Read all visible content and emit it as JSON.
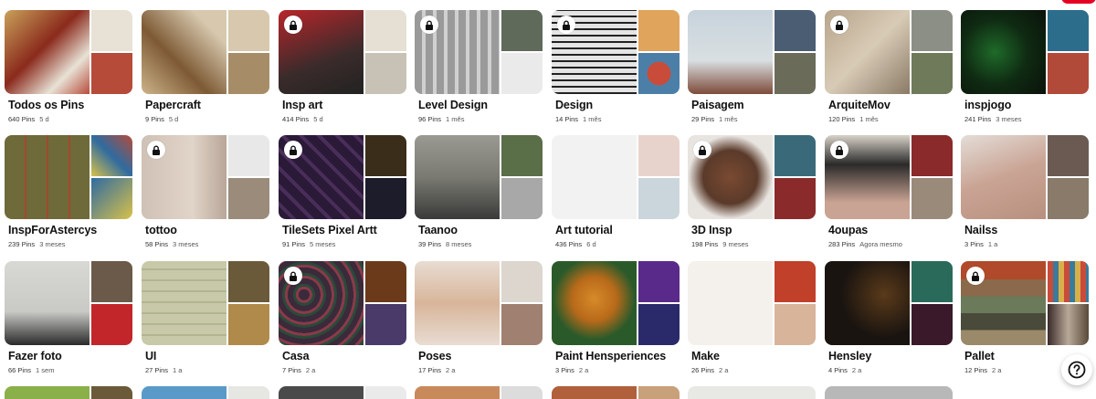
{
  "boards": [
    {
      "title": "Todos os Pins",
      "pins": "640 Pins",
      "time": "5 d",
      "locked": false,
      "colors": [
        "#c9a15a",
        "#8a2a1c",
        "#e8e2d6",
        "#b64b3a"
      ]
    },
    {
      "title": "Papercraft",
      "pins": "9 Pins",
      "time": "5 d",
      "locked": false,
      "colors": [
        "#cdb48a",
        "#7d5a35",
        "#d7c8ae",
        "#a78d67"
      ]
    },
    {
      "title": "Insp art",
      "pins": "414 Pins",
      "time": "5 d",
      "locked": true,
      "colors": [
        "#b7252a",
        "#3b2b2b",
        "#e6e0d4",
        "#222222"
      ]
    },
    {
      "title": "Level Design",
      "pins": "96 Pins",
      "time": "1 mês",
      "locked": true,
      "colors": [
        "#9a9a9a",
        "#5f6a5a",
        "#2e2e2e",
        "#eaeaea"
      ]
    },
    {
      "title": "Design",
      "pins": "14 Pins",
      "time": "1 mês",
      "locked": true,
      "colors": [
        "#d8d8d8",
        "#e0a45c",
        "#c94b3a",
        "#4c7fa8"
      ]
    },
    {
      "title": "Paisagem",
      "pins": "29 Pins",
      "time": "1 mês",
      "locked": false,
      "colors": [
        "#c7d3dc",
        "#7d4b3a",
        "#4b5d73",
        "#6b6b5a"
      ]
    },
    {
      "title": "ArquiteMov",
      "pins": "120 Pins",
      "time": "1 mês",
      "locked": true,
      "colors": [
        "#b7a48a",
        "#8c8f86",
        "#6e7a5a",
        "#a59c8a"
      ]
    },
    {
      "title": "inspjogo",
      "pins": "241 Pins",
      "time": "3 meses",
      "locked": false,
      "colors": [
        "#0f2a12",
        "#2c6d8c",
        "#b24a3a",
        "#1a1a1a"
      ]
    },
    {
      "title": "InspForAstercys",
      "pins": "239 Pins",
      "time": "3 meses",
      "locked": false,
      "colors": [
        "#6e6a3a",
        "#a04a2c",
        "#2f6ba0",
        "#d8c14a"
      ]
    },
    {
      "title": "tottoo",
      "pins": "58 Pins",
      "time": "3 meses",
      "locked": true,
      "colors": [
        "#cfc1b5",
        "#e8e8e8",
        "#9b8b7b",
        "#d6c3b8"
      ]
    },
    {
      "title": "TileSets Pixel Artt",
      "pins": "91 Pins",
      "time": "5 meses",
      "locked": true,
      "colors": [
        "#2a1a38",
        "#3a2e1a",
        "#1c1c2a",
        "#6a4a2a"
      ]
    },
    {
      "title": "Taanoo",
      "pins": "39 Pins",
      "time": "8 meses",
      "locked": false,
      "colors": [
        "#7a7a72",
        "#5a6e48",
        "#a8a8a8",
        "#3a3a3a"
      ]
    },
    {
      "title": "Art tutorial",
      "pins": "436 Pins",
      "time": "6 d",
      "locked": false,
      "colors": [
        "#f2f2f2",
        "#e8d3cc",
        "#cbd6dc",
        "#b8b8b8"
      ]
    },
    {
      "title": "3D Insp",
      "pins": "198 Pins",
      "time": "9 meses",
      "locked": true,
      "colors": [
        "#5a3a2a",
        "#3a6a7a",
        "#8a2a2a",
        "#6a3a2a"
      ]
    },
    {
      "title": "4oupas",
      "pins": "283 Pins",
      "time": "Agora mesmo",
      "locked": true,
      "colors": [
        "#3a3a38",
        "#8a2a2a",
        "#9a8a7a",
        "#2a2a2a"
      ]
    },
    {
      "title": "Nailss",
      "pins": "3 Pins",
      "time": "1 a",
      "locked": false,
      "colors": [
        "#c9a393",
        "#6a5a52",
        "#8a7a6a",
        "#b8b8b8"
      ]
    },
    {
      "title": "Fazer foto",
      "pins": "66 Pins",
      "time": "1 sem",
      "locked": false,
      "colors": [
        "#c9c9c6",
        "#6b5a4a",
        "#c2262a",
        "#d8c8b8"
      ]
    },
    {
      "title": "UI",
      "pins": "27 Pins",
      "time": "1 a",
      "locked": false,
      "colors": [
        "#c7c9a8",
        "#6a5a3a",
        "#9aa27a",
        "#b08a4a"
      ]
    },
    {
      "title": "Casa",
      "pins": "7 Pins",
      "time": "2 a",
      "locked": true,
      "colors": [
        "#3a2a3a",
        "#6a3a1a",
        "#8a3a4a",
        "#4a3a6a"
      ]
    },
    {
      "title": "Poses",
      "pins": "17 Pins",
      "time": "2 a",
      "locked": false,
      "colors": [
        "#e8dcd2",
        "#d8b59a",
        "#dcd6cf",
        "#a08070"
      ]
    },
    {
      "title": "Paint Hensperiences",
      "pins": "3 Pins",
      "time": "2 a",
      "locked": false,
      "colors": [
        "#2a5a2a",
        "#5a2a8a",
        "#2a2a6a",
        "#d88a2a"
      ]
    },
    {
      "title": "Make",
      "pins": "26 Pins",
      "time": "2 a",
      "locked": false,
      "colors": [
        "#f4f1ec",
        "#c0402a",
        "#d8b49a",
        "#d6d0c8"
      ]
    },
    {
      "title": "Hensley",
      "pins": "4 Pins",
      "time": "2 a",
      "locked": false,
      "colors": [
        "#1a1410",
        "#2a6a5a",
        "#3a1a2a",
        "#e8d8c8"
      ]
    },
    {
      "title": "Pallet",
      "pins": "12 Pins",
      "time": "2 a",
      "locked": true,
      "colors": [
        "#6a7a5a",
        "#b04a2a",
        "#4a4a3a",
        "#9a8a6a"
      ]
    }
  ],
  "partial_row": [
    {
      "colors": [
        "#8ab04a",
        "#6a5a3a"
      ]
    },
    {
      "colors": [
        "#5a9ac8",
        "#e6e6e2"
      ]
    },
    {
      "colors": [
        "#4a4a4a",
        "#eaeaea"
      ]
    },
    {
      "colors": [
        "#c88a5a",
        "#dcdcdc"
      ]
    },
    {
      "colors": [
        "#b0603a",
        "#c8a07a"
      ]
    },
    {
      "colors": [
        "#e8e8e4",
        "#ffffff"
      ]
    },
    {
      "colors": [
        "#b8b8b8",
        "#ffffff"
      ]
    }
  ],
  "accent": "#e60023"
}
